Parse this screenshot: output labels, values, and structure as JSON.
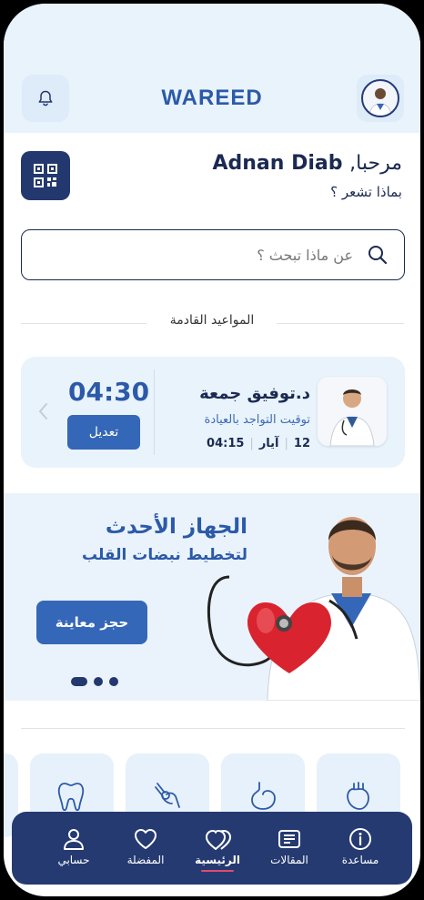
{
  "header": {
    "logo": "WAREED"
  },
  "greeting": {
    "hello": "مرحبا,",
    "name": "Adnan Diab",
    "question": "بماذا تشعر ؟"
  },
  "search": {
    "placeholder": "عن ماذا تبحث ؟"
  },
  "upcoming": {
    "title": "المواعيد القادمة",
    "appointment": {
      "doctor": "د.توفيق جمعة",
      "place": "توقيت التواجد بالعيادة",
      "day": "12",
      "month": "آيار",
      "clinic_time": "04:15",
      "time": "04:30",
      "edit_label": "تعديل"
    }
  },
  "banner": {
    "title": "الجهاز الأحدث",
    "subtitle": "لتخطيط نبضات القلب",
    "book_label": "حجز معاينة",
    "slides": 3,
    "active_slide": 1
  },
  "categories": [
    {
      "icon": "heart-organ-icon"
    },
    {
      "icon": "stomach-icon"
    },
    {
      "icon": "knee-joint-icon"
    },
    {
      "icon": "tooth-icon"
    }
  ],
  "nav": {
    "items": [
      {
        "icon": "info-icon",
        "label": "مساعدة"
      },
      {
        "icon": "articles-icon",
        "label": "المقالات"
      },
      {
        "icon": "home-hearts-icon",
        "label": "الرئيسية",
        "active": true
      },
      {
        "icon": "heart-outline-icon",
        "label": "المفضلة"
      },
      {
        "icon": "user-icon",
        "label": "حسابي"
      }
    ]
  },
  "colors": {
    "primary": "#3567b8",
    "navy": "#23386e",
    "light_bg": "#e9f3fc",
    "accent": "#e04a72"
  }
}
